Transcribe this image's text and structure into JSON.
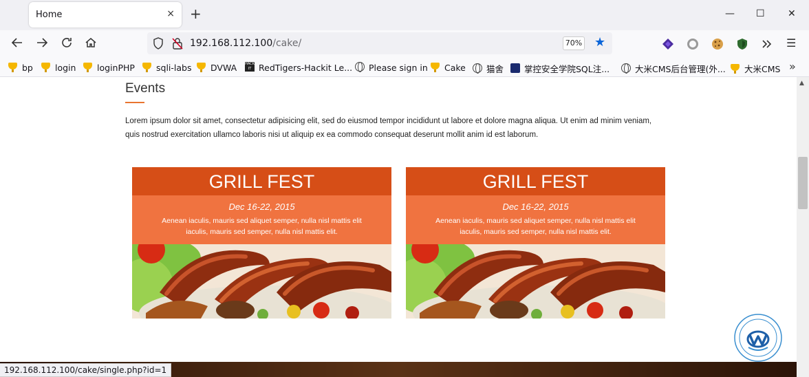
{
  "browser": {
    "tab_title": "Home",
    "tab_close": "×",
    "new_tab": "+",
    "window_controls": {
      "minimize": "—",
      "maximize": "☐",
      "close": "✕"
    },
    "url_host": "192.168.112.100",
    "url_path": "/cake/",
    "zoom": "70%",
    "status_url": "192.168.112.100/cake/single.php?id=1"
  },
  "bookmarks": [
    {
      "label": "bp",
      "icon": "trophy-icon"
    },
    {
      "label": "login",
      "icon": "trophy-icon"
    },
    {
      "label": "loginPHP",
      "icon": "trophy-icon"
    },
    {
      "label": "sqli-labs",
      "icon": "trophy-icon"
    },
    {
      "label": "DVWA",
      "icon": "trophy-icon"
    },
    {
      "label": "RedTigers-Hackit Le...",
      "icon": "redtigers-icon"
    },
    {
      "label": "Please sign in",
      "icon": "globe-icon"
    },
    {
      "label": "Cake",
      "icon": "trophy-icon"
    },
    {
      "label": "猫舍",
      "icon": "globe-icon"
    },
    {
      "label": "掌控安全学院SQL注...",
      "icon": "zkaq-icon"
    },
    {
      "label": "大米CMS后台管理(外...",
      "icon": "globe-icon"
    },
    {
      "label": "大米CMS",
      "icon": "trophy-icon"
    }
  ],
  "page": {
    "section_title": "Events",
    "intro": "Lorem ipsum dolor sit amet, consectetur adipisicing elit, sed do eiusmod tempor incididunt ut labore et dolore magna aliqua. Ut enim ad minim veniam, quis nostrud exercitation ullamco laboris nisi ut aliquip ex ea commodo consequat deserunt mollit anim id est laborum.",
    "events": [
      {
        "title": "GRILL FEST",
        "date": "Dec 16-22, 2015",
        "description": "Aenean iaculis, mauris sed aliquet semper, nulla nisl mattis elit iaculis, mauris sed semper, nulla nisl mattis elit."
      },
      {
        "title": "GRILL FEST",
        "date": "Dec 16-22, 2015",
        "description": "Aenean iaculis, mauris sed aliquet semper, nulla nisl mattis elit iaculis, mauris sed semper, nulla nisl mattis elit."
      }
    ]
  },
  "colors": {
    "card_header": "#d64e17",
    "card_body": "#f07340",
    "accent_rule": "#e8742f",
    "star": "#0a64d8"
  }
}
